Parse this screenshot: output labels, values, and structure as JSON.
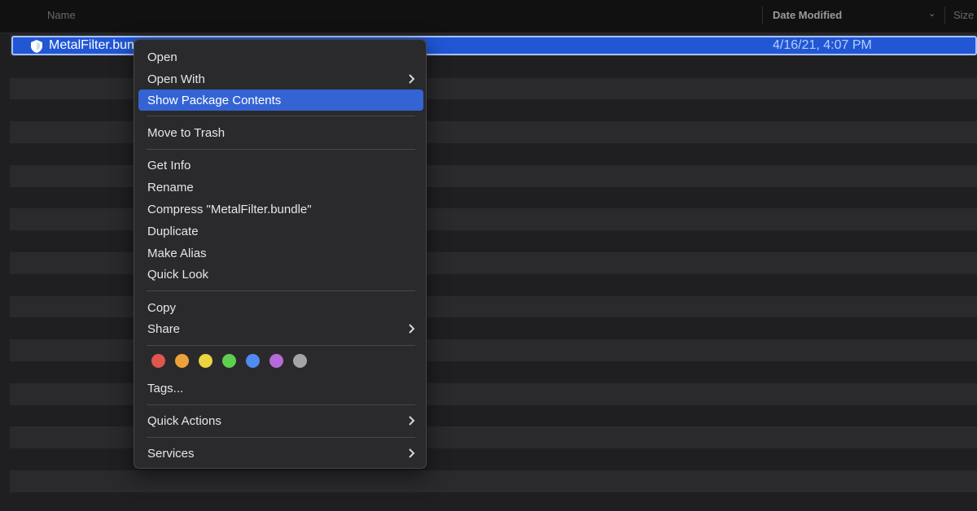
{
  "header": {
    "name_label": "Name",
    "date_label": "Date Modified",
    "size_label": "Size"
  },
  "file": {
    "name": "MetalFilter.bundle",
    "date": "4/16/21, 4:07 PM",
    "icon": "bundle-shield-icon"
  },
  "menu": {
    "open": "Open",
    "open_with": "Open With",
    "show_package_contents": "Show Package Contents",
    "move_to_trash": "Move to Trash",
    "get_info": "Get Info",
    "rename": "Rename",
    "compress": "Compress \"MetalFilter.bundle\"",
    "duplicate": "Duplicate",
    "make_alias": "Make Alias",
    "quick_look": "Quick Look",
    "copy": "Copy",
    "share": "Share",
    "tags": "Tags...",
    "quick_actions": "Quick Actions",
    "services": "Services",
    "highlighted_item": "Show Package Contents"
  },
  "tag_colors": [
    {
      "name": "Red",
      "color": "#e0564e"
    },
    {
      "name": "Orange",
      "color": "#eca23a"
    },
    {
      "name": "Yellow",
      "color": "#ecd33f"
    },
    {
      "name": "Green",
      "color": "#5fcf4f"
    },
    {
      "name": "Blue",
      "color": "#4f8bf0"
    },
    {
      "name": "Purple",
      "color": "#b66ad7"
    },
    {
      "name": "Gray",
      "color": "#a4a4a6"
    }
  ],
  "colors": {
    "selection": "#2157d5",
    "menu_highlight": "#3463d4"
  }
}
